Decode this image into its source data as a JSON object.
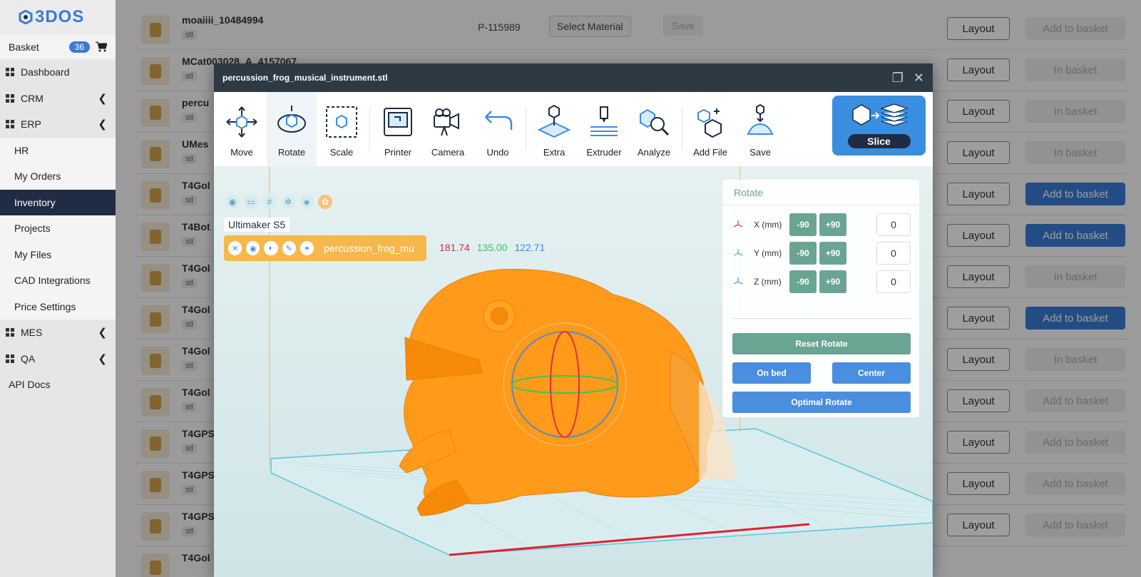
{
  "brand": {
    "logo_text": "3DOS"
  },
  "sidebar": {
    "basket_label": "Basket",
    "basket_count": "36",
    "items": [
      {
        "label": "Dashboard"
      },
      {
        "label": "CRM"
      },
      {
        "label": "ERP"
      }
    ],
    "erp_sub": [
      "HR",
      "My Orders",
      "Inventory",
      "Projects",
      "My Files",
      "CAD Integrations",
      "Price Settings"
    ],
    "mes_label": "MES",
    "qa_label": "QA",
    "api_label": "API Docs"
  },
  "list": {
    "rows": [
      {
        "name": "moaiiii_10484994",
        "ext": "stl",
        "pid": "P-115989",
        "material": "Select Material",
        "save": "Save",
        "layout": "Layout",
        "basket": "Add to basket",
        "basket_state": "add-disabled"
      },
      {
        "name": "MCat003028_A_4157067",
        "ext": "stl",
        "layout": "Layout",
        "basket": "In basket",
        "basket_state": "inbasket"
      },
      {
        "name": "percu",
        "ext": "stl",
        "layout": "Layout",
        "basket": "In basket",
        "basket_state": "inbasket"
      },
      {
        "name": "UMes",
        "ext": "stl",
        "layout": "Layout",
        "basket": "In basket",
        "basket_state": "inbasket"
      },
      {
        "name": "T4Gol",
        "ext": "stl",
        "layout": "Layout",
        "basket": "Add to basket",
        "basket_state": "add-active"
      },
      {
        "name": "T4Bot",
        "ext": "stl",
        "layout": "Layout",
        "basket": "Add to basket",
        "basket_state": "add-active"
      },
      {
        "name": "T4Gol",
        "ext": "stl",
        "layout": "Layout",
        "basket": "In basket",
        "basket_state": "inbasket"
      },
      {
        "name": "T4Gol",
        "ext": "stl",
        "layout": "Layout",
        "basket": "Add to basket",
        "basket_state": "add-active"
      },
      {
        "name": "T4Gol",
        "ext": "stl",
        "layout": "Layout",
        "basket": "In basket",
        "basket_state": "inbasket"
      },
      {
        "name": "T4Gol",
        "ext": "stl",
        "layout": "Layout",
        "basket": "Add to basket",
        "basket_state": "add-disabled"
      },
      {
        "name": "T4GPS",
        "ext": "stl",
        "layout": "Layout",
        "basket": "Add to basket",
        "basket_state": "add-disabled"
      },
      {
        "name": "T4GPS",
        "ext": "stl",
        "layout": "Layout",
        "basket": "Add to basket",
        "basket_state": "add-disabled"
      },
      {
        "name": "T4GPS",
        "ext": "stl",
        "layout": "Layout",
        "basket": "Add to basket",
        "basket_state": "add-disabled"
      },
      {
        "name": "T4Gol",
        "ext": "",
        "layout": "",
        "basket": "",
        "basket_state": ""
      }
    ]
  },
  "modal": {
    "title": "percussion_frog_musical_instrument.stl",
    "tools": {
      "move": "Move",
      "rotate": "Rotate",
      "scale": "Scale",
      "printer": "Printer",
      "camera": "Camera",
      "undo": "Undo",
      "extra": "Extra",
      "extruder": "Extruder",
      "analyze": "Analyze",
      "add_file": "Add File",
      "save": "Save",
      "slice": "Slice"
    },
    "viewport": {
      "printer_name": "Ultimaker S5",
      "object_name": "percussion_frog_mu",
      "dim_x": "181.74",
      "dim_y": "135.00",
      "dim_z": "122.71"
    },
    "rotate_panel": {
      "title": "Rotate",
      "x_label": "X (mm)",
      "y_label": "Y (mm)",
      "z_label": "Z (mm)",
      "minus": "-90",
      "plus": "+90",
      "x_value": "0",
      "y_value": "0",
      "z_value": "0",
      "reset": "Reset Rotate",
      "on_bed": "On bed",
      "center": "Center",
      "optimal": "Optimal Rotate"
    }
  },
  "colors": {
    "accent": "#3a7bd5",
    "model": "#ff9a1a",
    "header": "#2e3a43",
    "rotate_btn": "#6aa593"
  }
}
